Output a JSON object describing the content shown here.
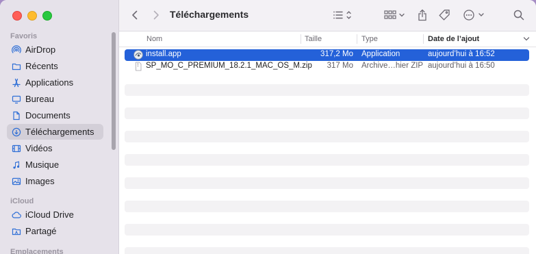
{
  "window": {
    "title": "Téléchargements"
  },
  "sidebar": {
    "sections": [
      {
        "label": "Favoris"
      },
      {
        "label": "iCloud"
      },
      {
        "label": "Emplacements"
      }
    ],
    "favorites": [
      {
        "label": "AirDrop",
        "icon": "airdrop-icon"
      },
      {
        "label": "Récents",
        "icon": "folder-icon"
      },
      {
        "label": "Applications",
        "icon": "applications-icon"
      },
      {
        "label": "Bureau",
        "icon": "desktop-icon"
      },
      {
        "label": "Documents",
        "icon": "document-icon"
      },
      {
        "label": "Téléchargements",
        "icon": "download-icon",
        "active": true
      },
      {
        "label": "Vidéos",
        "icon": "film-icon"
      },
      {
        "label": "Musique",
        "icon": "music-icon"
      },
      {
        "label": "Images",
        "icon": "photo-icon"
      }
    ],
    "icloud": [
      {
        "label": "iCloud Drive",
        "icon": "cloud-icon"
      },
      {
        "label": "Partagé",
        "icon": "shared-folder-icon"
      }
    ]
  },
  "columns": {
    "name": "Nom",
    "size": "Taille",
    "kind": "Type",
    "date": "Date de l’ajout"
  },
  "files": [
    {
      "name": "install.app",
      "size": "317,2 Mo",
      "kind": "Application",
      "date": "aujourd’hui à 16:52",
      "selected": true
    },
    {
      "name": "SP_MO_C_PREMIUM_18.2.1_MAC_OS_M.zip",
      "size": "317 Mo",
      "kind": "Archive…hier ZIP",
      "date": "aujourd’hui à 16:50",
      "selected": false
    }
  ],
  "colors": {
    "accent": "#2461d9",
    "sidebar_bg": "#e6e2ea",
    "desktop_bg": "#a58cc4"
  }
}
